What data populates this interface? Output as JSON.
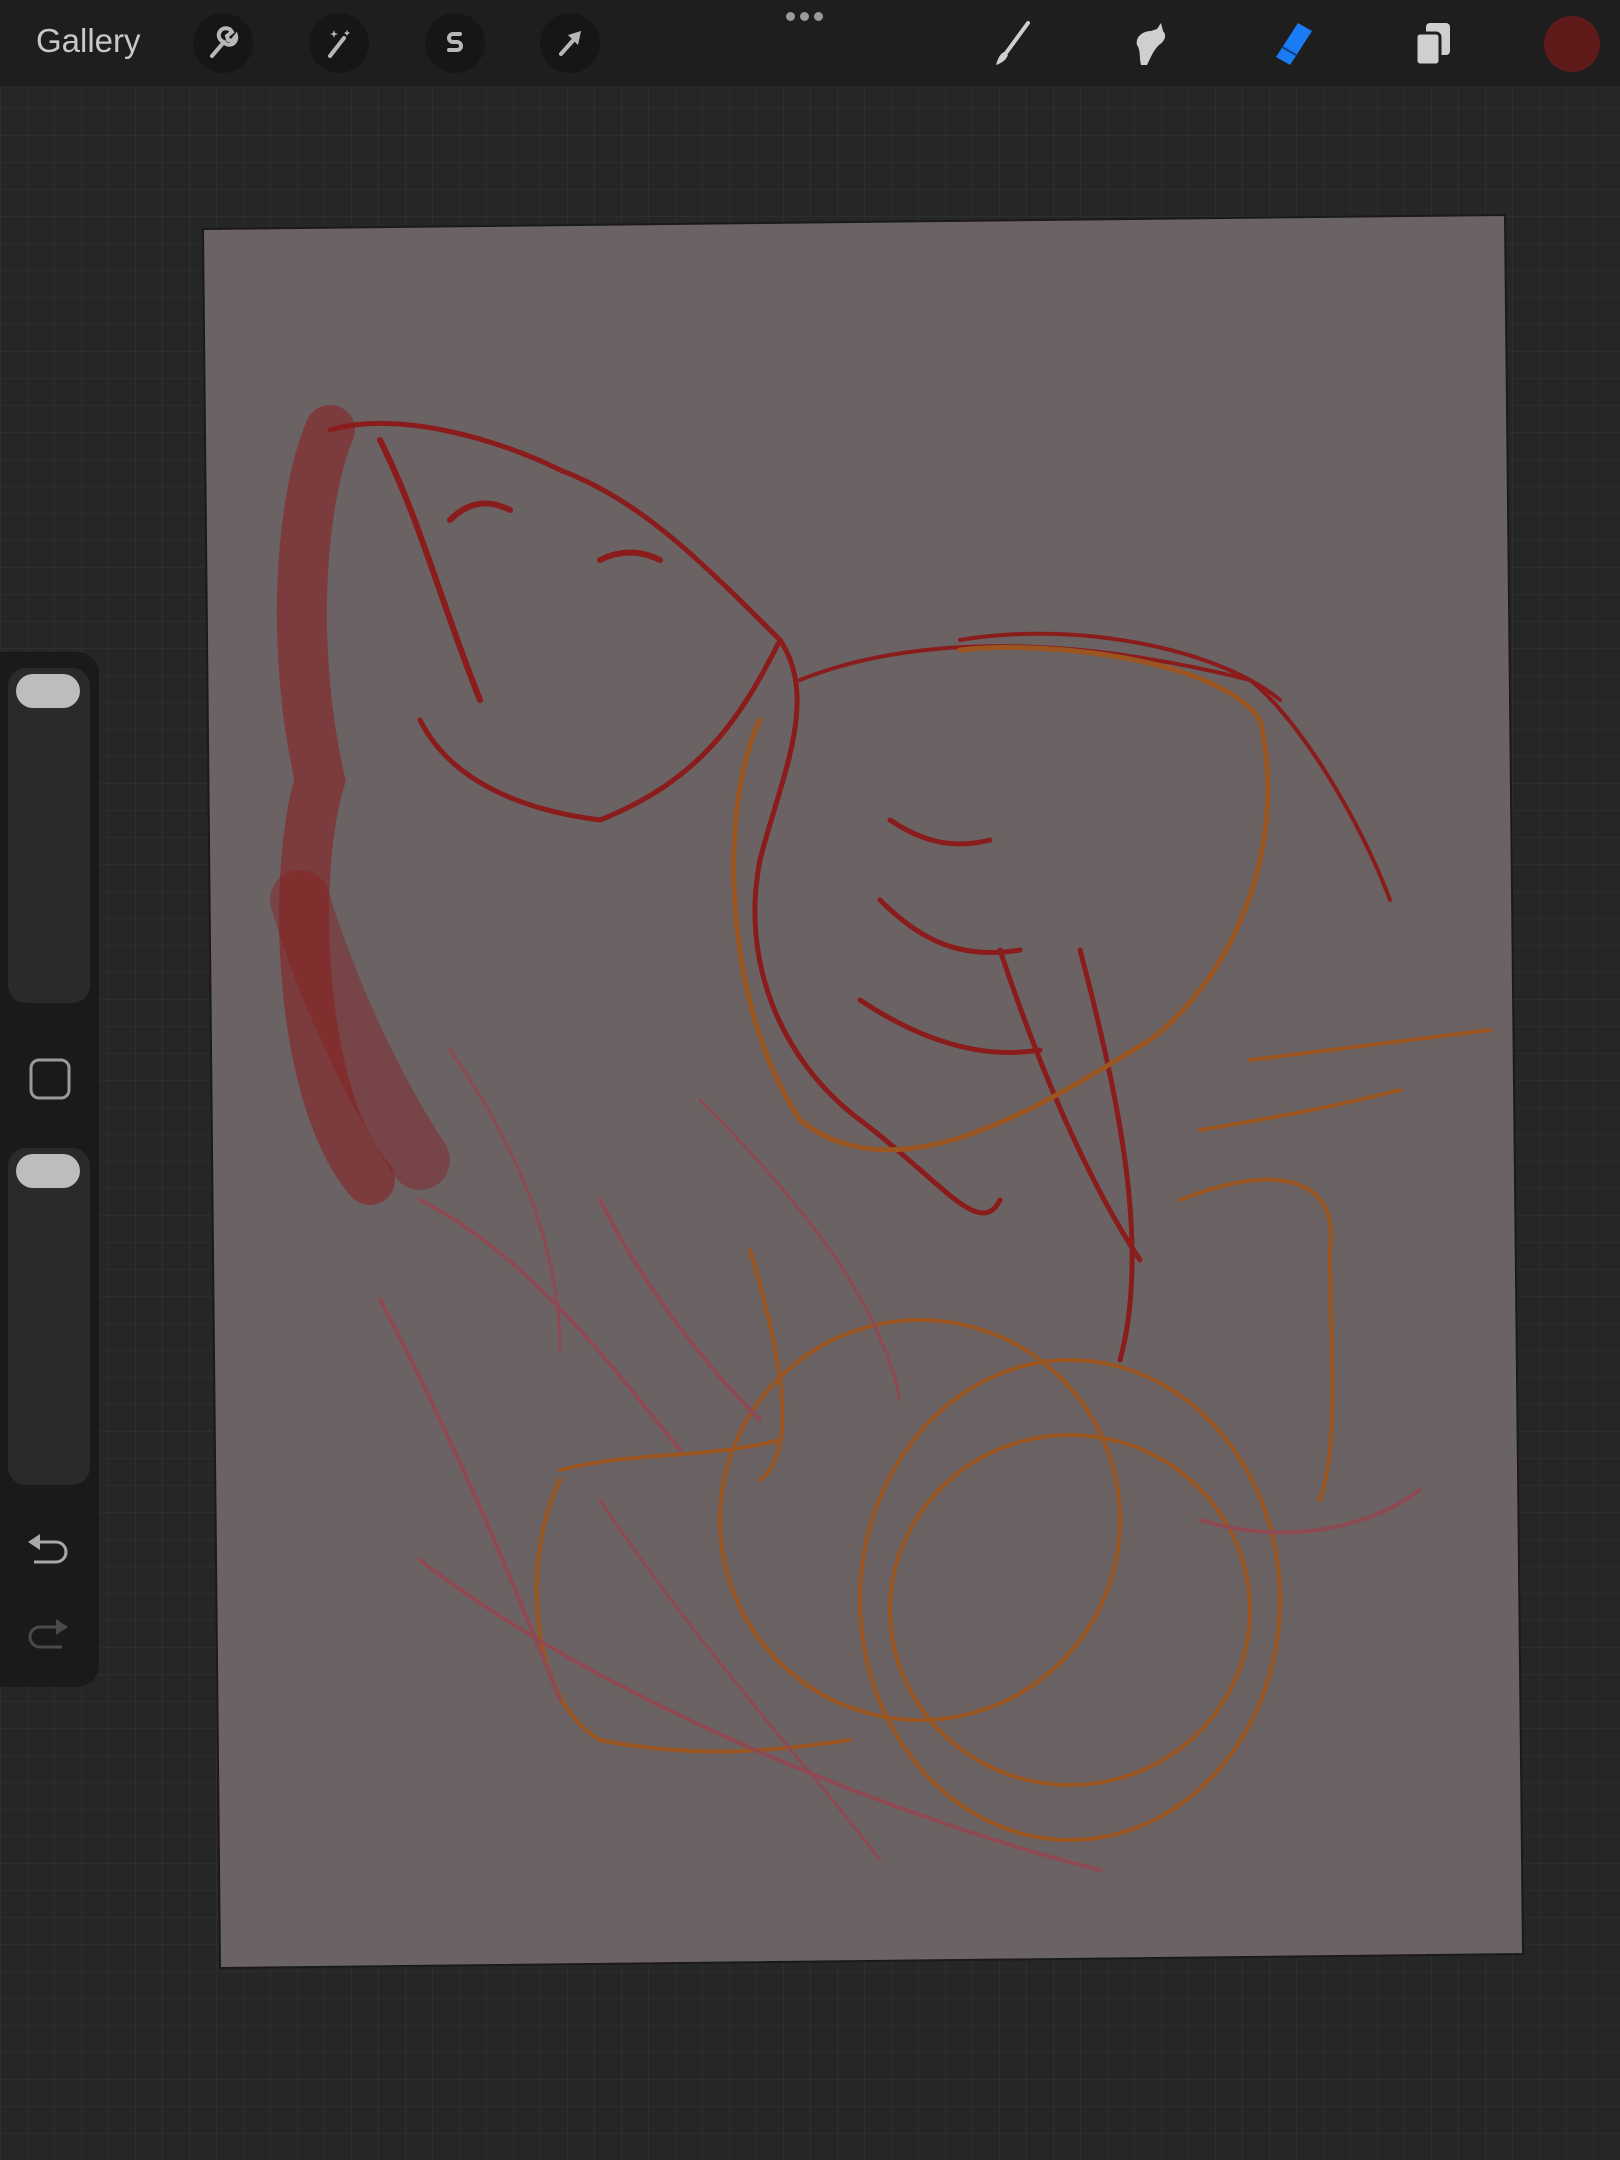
{
  "topbar": {
    "gallery_label": "Gallery",
    "left_tools": [
      "wrench-icon",
      "magic-wand-icon",
      "selection-icon",
      "transform-arrow-icon"
    ],
    "right_tools": [
      "brush-icon",
      "smudge-icon",
      "eraser-icon",
      "layers-icon"
    ],
    "active_tool": "eraser",
    "accent": "#1a7cf5",
    "current_color": "#5f1a1a"
  },
  "canvas": {
    "paper_color": "#6b6264",
    "stroke_colors": [
      "#8a1c1c",
      "#9a5520",
      "#8e4a52"
    ]
  },
  "sidebar": {
    "brush_size": 1.0,
    "opacity": 1.0
  }
}
